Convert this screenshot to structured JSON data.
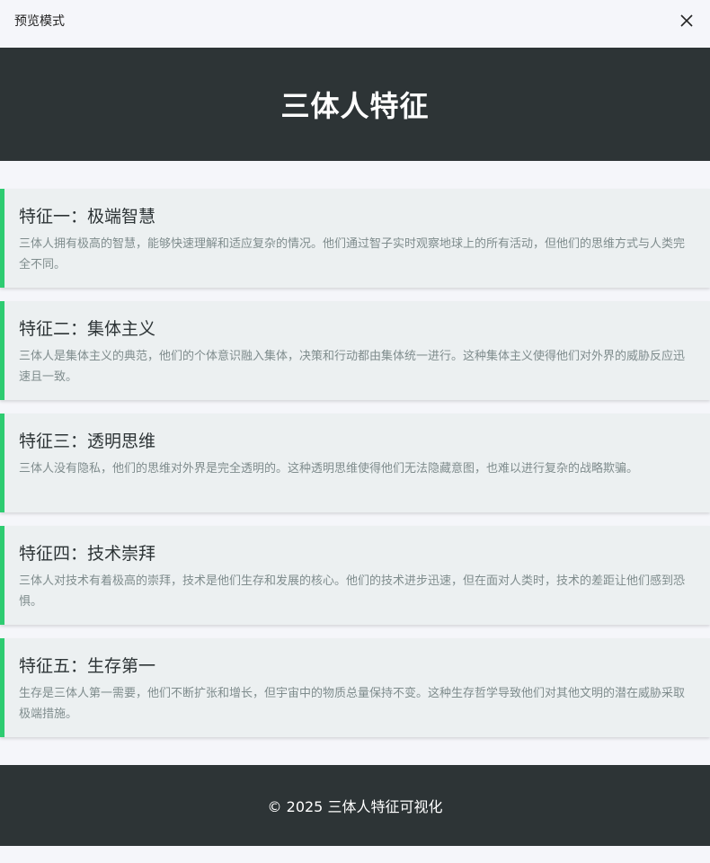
{
  "topbar": {
    "title": "预览模式",
    "close_icon": "close-icon"
  },
  "header": {
    "title": "三体人特征"
  },
  "features": [
    {
      "title": "特征一：极端智慧",
      "desc": "三体人拥有极高的智慧，能够快速理解和适应复杂的情况。他们通过智子实时观察地球上的所有活动，但他们的思维方式与人类完全不同。"
    },
    {
      "title": "特征二：集体主义",
      "desc": "三体人是集体主义的典范，他们的个体意识融入集体，决策和行动都由集体统一进行。这种集体主义使得他们对外界的威胁反应迅速且一致。"
    },
    {
      "title": "特征三：透明思维",
      "desc": "三体人没有隐私，他们的思维对外界是完全透明的。这种透明思维使得他们无法隐藏意图，也难以进行复杂的战略欺骗。"
    },
    {
      "title": "特征四：技术崇拜",
      "desc": "三体人对技术有着极高的崇拜，技术是他们生存和发展的核心。他们的技术进步迅速，但在面对人类时，技术的差距让他们感到恐惧。"
    },
    {
      "title": "特征五：生存第一",
      "desc": "生存是三体人第一需要，他们不断扩张和增长，但宇宙中的物质总量保持不变。这种生存哲学导致他们对其他文明的潜在威胁采取极端措施。"
    }
  ],
  "footer": {
    "text": "© 2025 三体人特征可视化"
  },
  "colors": {
    "accent": "#2ecc71",
    "header_bg": "#2d3436",
    "card_bg": "#ecf0f1"
  }
}
